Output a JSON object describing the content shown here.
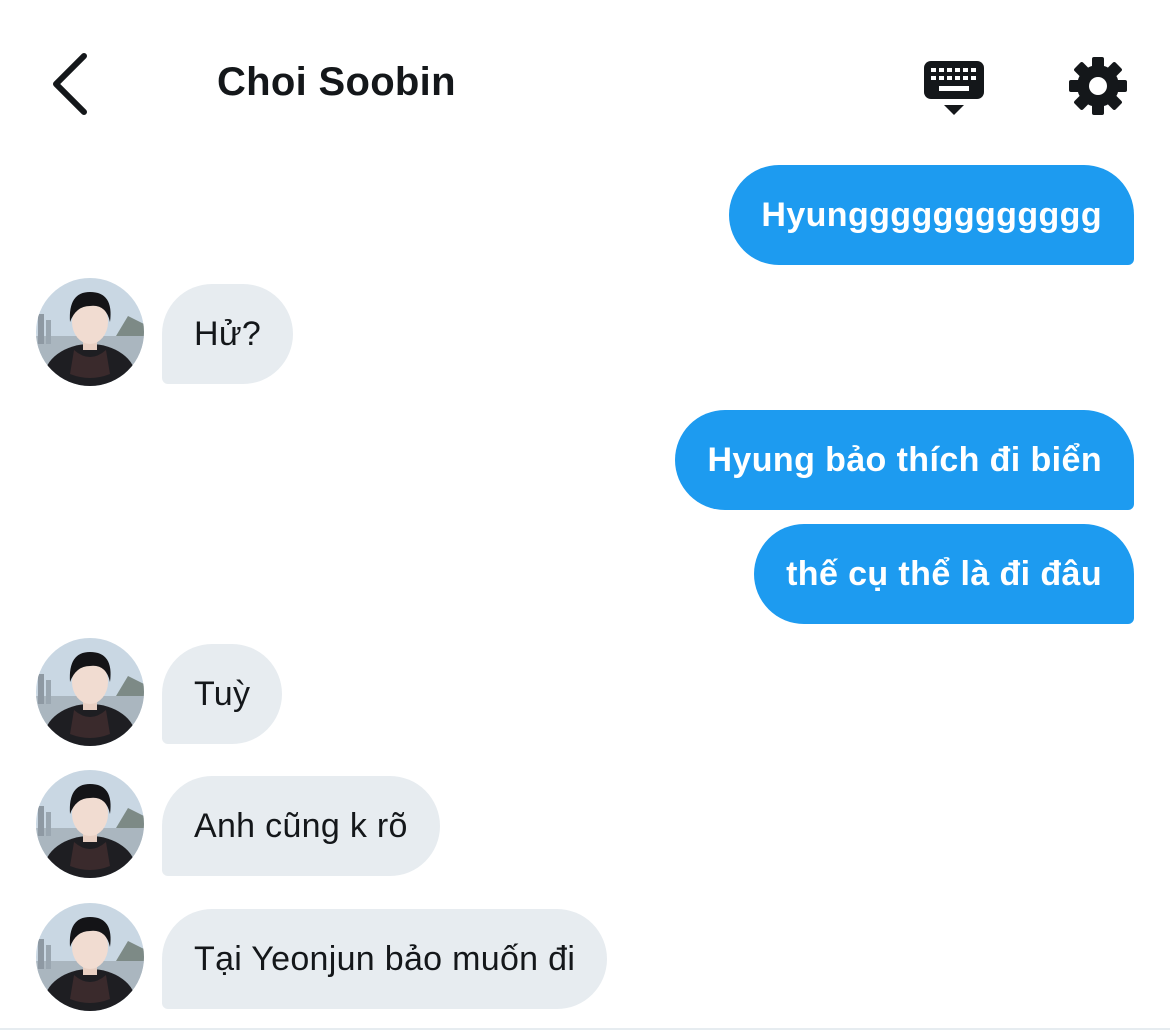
{
  "header": {
    "title": "Choi Soobin",
    "back_icon": "chevron-left-icon",
    "keyboard_icon": "keyboard-icon",
    "settings_icon": "gear-icon"
  },
  "colors": {
    "sent_bubble": "#1d9bf0",
    "received_bubble": "#e7ecf0",
    "text_dark": "#14171a"
  },
  "messages": [
    {
      "from": "me",
      "text": "Hyungggggggggggg"
    },
    {
      "from": "contact",
      "text": "Hử?"
    },
    {
      "from": "me",
      "text": "Hyung bảo thích đi biển"
    },
    {
      "from": "me",
      "text": "thế cụ thể là đi đâu"
    },
    {
      "from": "contact",
      "text": "Tuỳ"
    },
    {
      "from": "contact",
      "text": "Anh cũng k rõ"
    },
    {
      "from": "contact",
      "text": "Tại Yeonjun bảo muốn đi"
    }
  ]
}
